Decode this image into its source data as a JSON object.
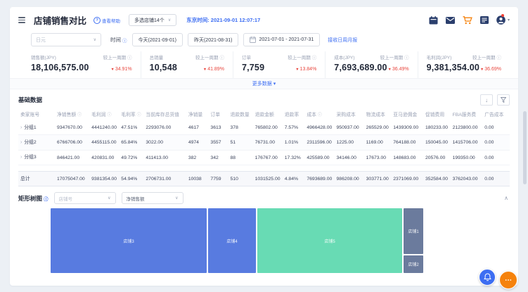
{
  "glyphs": {
    "down_triangle": "▼",
    "caret_down": "∨",
    "caret_up": "∧",
    "more_caret": "▾",
    "dropdown_caret": "▾",
    "info": "ⓘ",
    "expand": "›",
    "download": "↓",
    "question": "?",
    "ellipsis": "⋯"
  },
  "colors": {
    "accent_blue": "#3d6ef2",
    "delta_red": "#e8473f",
    "navy_icon": "#2b3f6d",
    "orange": "#f5820c",
    "treemap_blue": "#587be0",
    "treemap_green": "#68dbb4",
    "treemap_slate": "#6b7b9d"
  },
  "header": {
    "title": "店铺销售对比",
    "help_link": "查看帮助",
    "store_selector": "多选店铺14个",
    "tokyo_time": "东京时间: 2021-09-01 12:07:17"
  },
  "filters": {
    "currency_placeholder": "日元",
    "time_label": "时间",
    "today_button": "今天(2021-09-01)",
    "yesterday_button": "昨天(2021-08-31)",
    "date_range": "2021-07-01  -  2021-07-31",
    "report_link": "接收日周月报"
  },
  "kpis": [
    {
      "label": "销售额(JPY)",
      "compare_label": "较上一周期",
      "value": "18,106,575.00",
      "delta": "34.91%",
      "direction": "down"
    },
    {
      "label": "总销量",
      "compare_label": "较上一周期",
      "value": "10,548",
      "delta": "41.89%",
      "direction": "down"
    },
    {
      "label": "订单",
      "compare_label": "较上一周期",
      "value": "7,759",
      "delta": "13.84%",
      "direction": "down"
    },
    {
      "label": "成本(JPY)",
      "compare_label": "较上一周期",
      "value": "7,693,689.00",
      "delta": "36.49%",
      "direction": "down"
    },
    {
      "label": "毛利润(JPY)",
      "compare_label": "较上一周期",
      "value": "9,381,354.00",
      "delta": "36.69%",
      "direction": "down"
    }
  ],
  "more_data_link": "更多数据",
  "basic_table": {
    "section_title": "基础数据",
    "headers": [
      {
        "label": "卖家账号"
      },
      {
        "label": "净销售额",
        "info": true
      },
      {
        "label": "毛利润",
        "info": true
      },
      {
        "label": "毛利率",
        "info": true
      },
      {
        "label": "当前库存总货值"
      },
      {
        "label": "净销量"
      },
      {
        "label": "订单"
      },
      {
        "label": "退款数量"
      },
      {
        "label": "退款金额"
      },
      {
        "label": "退款率"
      },
      {
        "label": "成本",
        "info": true
      },
      {
        "label": "采购成本"
      },
      {
        "label": "物流成本"
      },
      {
        "label": "亚马逊佣金"
      },
      {
        "label": "促销费用"
      },
      {
        "label": "FBA服务费"
      },
      {
        "label": "广告成本"
      }
    ],
    "rows": [
      {
        "name": "分组1",
        "cells": [
          "9347670.00",
          "4441240.00",
          "47.51%",
          "2293076.00",
          "4617",
          "3613",
          "378",
          "765802.00",
          "7.57%",
          "4966428.00",
          "950937.00",
          "265529.00",
          "1439309.00",
          "180233.00",
          "2123800.00",
          "0.00"
        ]
      },
      {
        "name": "分组2",
        "cells": [
          "6766706.00",
          "4455115.00",
          "65.84%",
          "3022.00",
          "4974",
          "3557",
          "51",
          "76731.00",
          "1.01%",
          "2311596.00",
          "1225.00",
          "1169.00",
          "764188.00",
          "150045.00",
          "1415706.00",
          "0.00"
        ]
      },
      {
        "name": "分组3",
        "cells": [
          "846421.00",
          "420831.00",
          "49.72%",
          "411413.00",
          "382",
          "342",
          "88",
          "176767.00",
          "17.32%",
          "425589.00",
          "34146.00",
          "17673.00",
          "148683.00",
          "20576.00",
          "199350.00",
          "0.00"
        ]
      }
    ],
    "total": {
      "name": "总计",
      "cells": [
        "17075047.00",
        "9381354.00",
        "54.94%",
        "2706731.00",
        "10038",
        "7759",
        "510",
        "1031525.00",
        "4.84%",
        "7693689.00",
        "986208.00",
        "303771.00",
        "2371069.00",
        "352584.00",
        "3762043.00",
        "0.00"
      ]
    }
  },
  "treemap": {
    "section_title": "矩形树图",
    "dimension_placeholder": "店铺号",
    "metric_selected": "净销售额",
    "blocks": [
      {
        "label": "店铺3"
      },
      {
        "label": "店铺4"
      },
      {
        "label": "店铺5"
      },
      {
        "label": "店铺1"
      },
      {
        "label": "店铺2"
      }
    ]
  },
  "chart_data": {
    "type": "treemap",
    "title": "矩形树图",
    "metric": "净销售额",
    "legend_position": "none",
    "items": [
      {
        "name": "店铺3",
        "color": "#587be0",
        "area_share_pct": 40
      },
      {
        "name": "店铺4",
        "color": "#587be0",
        "area_share_pct": 12.5
      },
      {
        "name": "店铺5",
        "color": "#68dbb4",
        "area_share_pct": 38.5
      },
      {
        "name": "店铺1",
        "color": "#6b7b9d",
        "area_share_pct": 6.5
      },
      {
        "name": "店铺2",
        "color": "#6b7b9d",
        "area_share_pct": 2.5
      }
    ]
  }
}
